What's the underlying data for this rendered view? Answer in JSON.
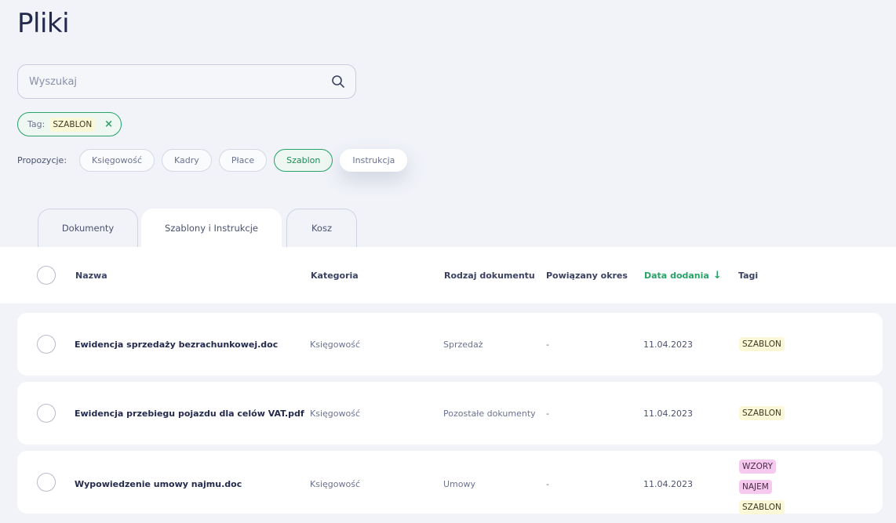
{
  "page": {
    "title": "Pliki"
  },
  "search": {
    "placeholder": "Wyszukaj"
  },
  "active_filter": {
    "label": "Tag:",
    "value": "SZABLON",
    "remove": "×"
  },
  "proposals": {
    "label": "Propozycje:",
    "items": [
      "Księgowość",
      "Kadry",
      "Płace",
      "Szablon",
      "Instrukcja"
    ],
    "selected": "Szablon"
  },
  "tabs": [
    "Dokumenty",
    "Szablony i Instrukcje",
    "Kosz"
  ],
  "active_tab": "Szablony i Instrukcje",
  "table": {
    "columns": {
      "name": "Nazwa",
      "category": "Kategoria",
      "doc_type": "Rodzaj dokumentu",
      "period": "Powiązany okres",
      "date": "Data dodania",
      "tags": "Tagi"
    },
    "sort_arrow": "↓",
    "rows": [
      {
        "name": "Ewidencja sprzedaży bezrachunkowej.doc",
        "category": "Księgowość",
        "doc_type": "Sprzedaż",
        "period": "-",
        "date": "11.04.2023",
        "tags": [
          "SZABLON"
        ]
      },
      {
        "name": "Ewidencja przebiegu pojazdu dla celów VAT.pdf",
        "category": "Księgowość",
        "doc_type": "Pozostałe dokumenty",
        "period": "-",
        "date": "11.04.2023",
        "tags": [
          "SZABLON"
        ]
      },
      {
        "name": "Wypowiedzenie umowy najmu.doc",
        "category": "Księgowość",
        "doc_type": "Umowy",
        "period": "-",
        "date": "11.04.2023",
        "tags": [
          "WZORY",
          "NAJEM",
          "SZABLON"
        ]
      }
    ]
  },
  "colors": {
    "accent": "#27a368",
    "tag_yellow": "#fbf8d8",
    "tag_pink": "#f6c9ee",
    "text_dark": "#232a4e"
  }
}
